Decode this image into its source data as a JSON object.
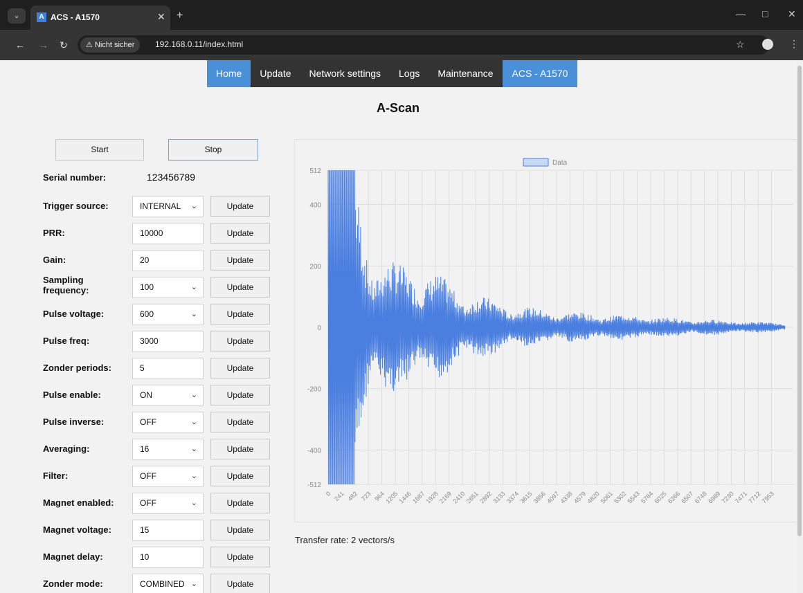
{
  "browser": {
    "tab_title": "ACS - A1570",
    "tab_favicon": "A",
    "security_chip": "⚠ Nicht sicher",
    "url": "192.168.0.11/index.html"
  },
  "nav": {
    "items": [
      "Home",
      "Update",
      "Network settings",
      "Logs",
      "Maintenance",
      "ACS - A1570"
    ],
    "active": "Home"
  },
  "page": {
    "title": "A-Scan",
    "start_label": "Start",
    "stop_label": "Stop",
    "serial_label": "Serial number:",
    "serial_value": "123456789",
    "update_label": "Update",
    "transfer_rate": "Transfer rate: 2 vectors/s"
  },
  "settings": [
    {
      "label": "Trigger source:",
      "value": "INTERNAL",
      "type": "select"
    },
    {
      "label": "PRR:",
      "value": "10000",
      "type": "input"
    },
    {
      "label": "Gain:",
      "value": "20",
      "type": "input"
    },
    {
      "label": "Sampling frequency:",
      "value": "100",
      "type": "select"
    },
    {
      "label": "Pulse voltage:",
      "value": "600",
      "type": "select"
    },
    {
      "label": "Pulse freq:",
      "value": "3000",
      "type": "input"
    },
    {
      "label": "Zonder periods:",
      "value": "5",
      "type": "input"
    },
    {
      "label": "Pulse enable:",
      "value": "ON",
      "type": "select"
    },
    {
      "label": "Pulse inverse:",
      "value": "OFF",
      "type": "select"
    },
    {
      "label": "Averaging:",
      "value": "16",
      "type": "select"
    },
    {
      "label": "Filter:",
      "value": "OFF",
      "type": "select"
    },
    {
      "label": "Magnet enabled:",
      "value": "OFF",
      "type": "select"
    },
    {
      "label": "Magnet voltage:",
      "value": "15",
      "type": "input"
    },
    {
      "label": "Magnet delay:",
      "value": "10",
      "type": "input"
    },
    {
      "label": "Zonder mode:",
      "value": "COMBINED",
      "type": "select"
    }
  ],
  "colors": {
    "accent": "#4a90d9",
    "series": "#4a7fe0"
  },
  "chart_data": {
    "type": "line",
    "legend": "Data",
    "legend_position": "top-center",
    "grid": true,
    "ylim": [
      -512,
      512
    ],
    "y_ticks": [
      -512,
      -400,
      -200,
      0,
      200,
      400,
      512
    ],
    "x_range": [
      0,
      8194
    ],
    "x_ticks": [
      "0",
      "241",
      "482",
      "723",
      "964",
      "1205",
      "1446",
      "1687",
      "1928",
      "2169",
      "2410",
      "2651",
      "2892",
      "3133",
      "3374",
      "3615",
      "3856",
      "4097",
      "4338",
      "4579",
      "4820",
      "5061",
      "5302",
      "5543",
      "5784",
      "6025",
      "6266",
      "6507",
      "6748",
      "6989",
      "7230",
      "7471",
      "7712",
      "7953"
    ],
    "envelope": {
      "description_points_x": [
        0,
        482,
        723,
        964,
        1446,
        1928,
        2410,
        2892,
        3374,
        4097,
        4820,
        5543,
        6266,
        6989,
        7712,
        8194
      ],
      "amplitude": [
        512,
        512,
        260,
        230,
        200,
        180,
        120,
        95,
        70,
        55,
        45,
        40,
        30,
        25,
        18,
        15
      ]
    }
  }
}
